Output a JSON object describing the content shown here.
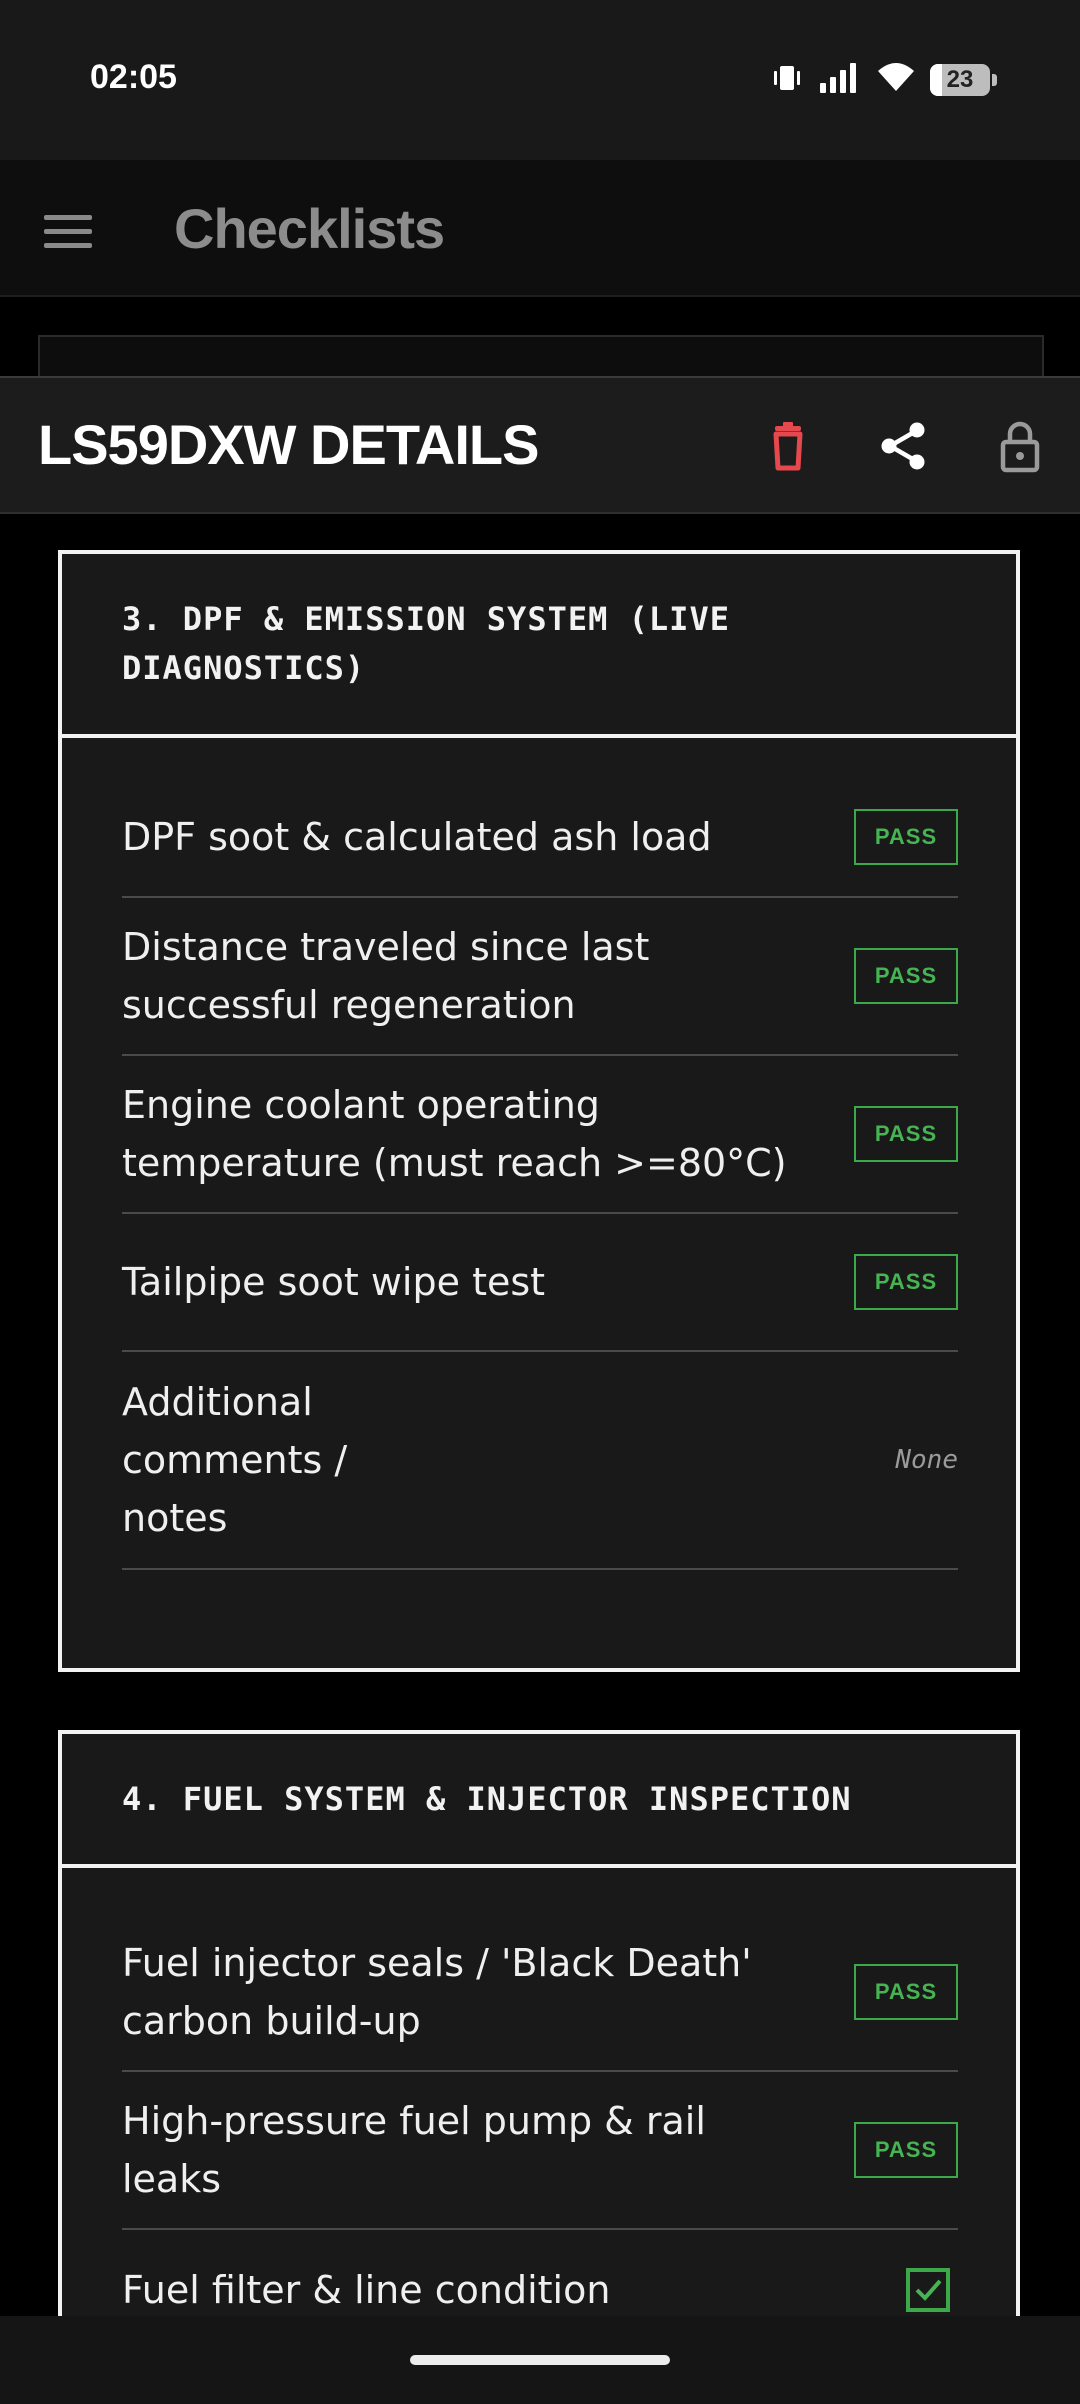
{
  "status_bar": {
    "time": "02:05",
    "battery_level": "23",
    "icons": [
      "vibrate-icon",
      "signal-icon",
      "wifi-icon",
      "battery-icon"
    ]
  },
  "app_bar": {
    "title": "Checklists",
    "menu_icon": "hamburger-icon"
  },
  "sheet": {
    "title": "LS59DXW DETAILS",
    "actions": [
      {
        "icon": "trash-icon",
        "color": "#e5484d"
      },
      {
        "icon": "share-icon",
        "color": "#ffffff"
      },
      {
        "icon": "lock-icon",
        "color": "#9a9a9a"
      }
    ]
  },
  "sections": [
    {
      "title": "3. DPF & EMISSION SYSTEM (LIVE DIAGNOSTICS)",
      "items": [
        {
          "label": "DPF soot & calculated ash load",
          "status": "PASS"
        },
        {
          "label": "Distance traveled since last successful regeneration",
          "status": "PASS"
        },
        {
          "label": "Engine coolant operating temperature (must reach >=80°C)",
          "status": "PASS"
        },
        {
          "label": "Tailpipe soot wipe test",
          "status": "PASS"
        },
        {
          "label": "Additional comments / notes",
          "value": "None"
        }
      ]
    },
    {
      "title": "4. FUEL SYSTEM & INJECTOR INSPECTION",
      "items": [
        {
          "label": "Fuel injector seals / 'Black Death' carbon build-up",
          "status": "PASS"
        },
        {
          "label": "High-pressure fuel pump & rail leaks",
          "status": "PASS"
        },
        {
          "label": "Fuel filter & line condition",
          "checked": true
        }
      ]
    }
  ],
  "colors": {
    "pass_green": "#46b452",
    "delete_red": "#e5484d",
    "background": "#000000",
    "card": "#191919"
  }
}
